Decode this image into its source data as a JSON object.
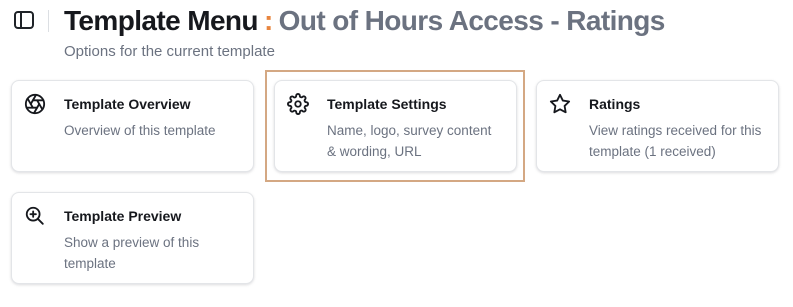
{
  "header": {
    "title": "Template Menu",
    "separator": ":",
    "subtitle_name": "Out of Hours Access - Ratings",
    "description": "Options for the current template"
  },
  "colors": {
    "accent": "#e8853f",
    "muted_text": "#6b7280",
    "highlight_border": "#d4a883"
  },
  "cards": [
    {
      "title": "Template Overview",
      "description": "Overview of this template",
      "icon": "aperture-icon"
    },
    {
      "title": "Template Settings",
      "description": "Name, logo, survey content & wording, URL",
      "icon": "gear-icon",
      "highlighted": true
    },
    {
      "title": "Ratings",
      "description": "View ratings received for this template (1 received)",
      "icon": "star-icon"
    },
    {
      "title": "Template Preview",
      "description": "Show a preview of this template",
      "icon": "zoom-in-icon"
    }
  ]
}
